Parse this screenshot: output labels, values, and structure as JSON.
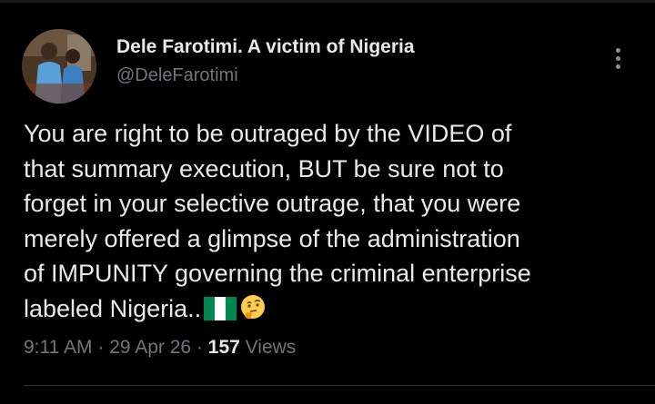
{
  "author": {
    "display_name": "Dele Farotimi. A victim of Nigeria",
    "handle": "@DeleFarotimi"
  },
  "tweet": {
    "lines": [
      "You are right to be outraged by the VIDEO of",
      "that summary execution, BUT be sure not to",
      "forget in your selective outrage, that you were",
      "merely offered a glimpse of the administration",
      "of IMPUNITY governing the criminal enterprise",
      "labeled Nigeria.."
    ],
    "emojis": [
      "nigeria-flag-icon",
      "thinking-face-icon"
    ]
  },
  "meta": {
    "time": "9:11 AM",
    "separator": "·",
    "date": "29 Apr 26",
    "views_count": "157",
    "views_label": "Views"
  },
  "colors": {
    "background": "#000000",
    "primary_text": "#e7e9ea",
    "secondary_text": "#71767b"
  }
}
